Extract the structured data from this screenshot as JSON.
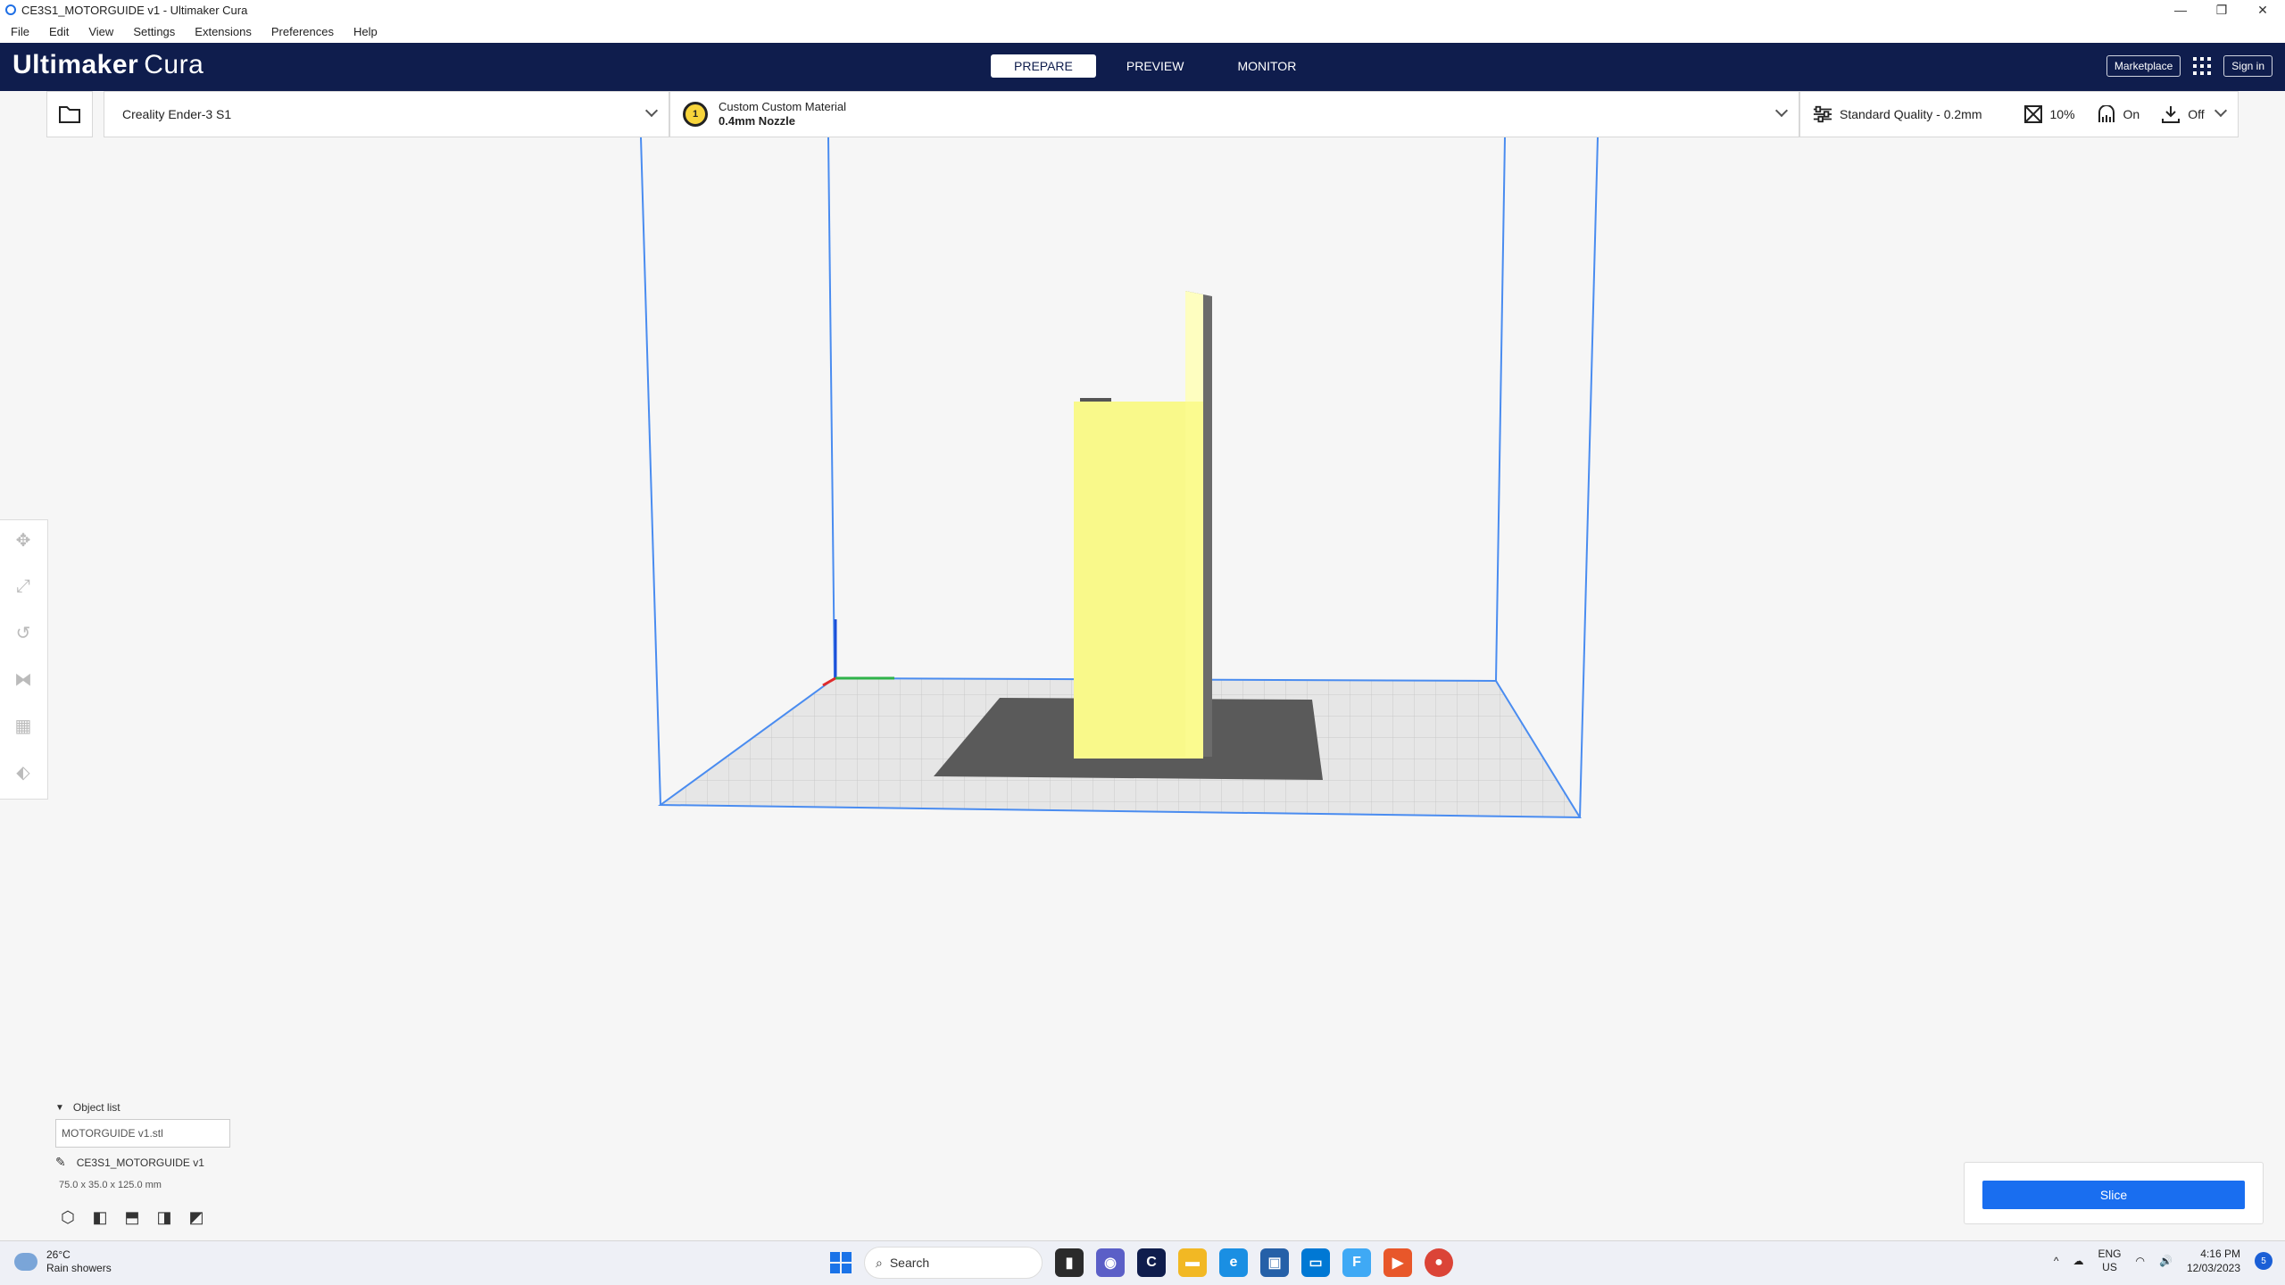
{
  "window": {
    "title": "CE3S1_MOTORGUIDE v1 - Ultimaker Cura",
    "controls": {
      "minimize": "—",
      "maximize": "❐",
      "close": "✕"
    }
  },
  "menu": [
    "File",
    "Edit",
    "View",
    "Settings",
    "Extensions",
    "Preferences",
    "Help"
  ],
  "header": {
    "logo_bold": "Ultimaker",
    "logo_thin": "Cura",
    "stages": [
      {
        "label": "PREPARE",
        "active": true
      },
      {
        "label": "PREVIEW",
        "active": false
      },
      {
        "label": "MONITOR",
        "active": false
      }
    ],
    "marketplace": "Marketplace",
    "signin": "Sign in"
  },
  "printer": {
    "name": "Creality Ender-3 S1"
  },
  "material": {
    "extruder_number": "1",
    "name": "Custom Custom Material",
    "nozzle": "0.4mm Nozzle",
    "extruder_color": "#f7d43b"
  },
  "quality": {
    "profile": "Standard Quality - 0.2mm",
    "infill": "10%",
    "support": "On",
    "adhesion": "Off"
  },
  "tools": [
    "move-icon",
    "scale-icon",
    "rotate-icon",
    "mirror-icon",
    "per-model-settings-icon",
    "support-blocker-icon"
  ],
  "objects": {
    "list_label": "Object list",
    "file": "MOTORGUIDE v1.stl",
    "job_name": "CE3S1_MOTORGUIDE v1",
    "dimensions": "75.0 x 35.0 x 125.0 mm"
  },
  "slice": {
    "label": "Slice",
    "color": "#196ef0"
  },
  "taskbar": {
    "temp": "26°C",
    "weather": "Rain showers",
    "search": "Search",
    "lang_top": "ENG",
    "lang_bottom": "US",
    "time": "4:16 PM",
    "date": "12/03/2023",
    "notifications": "5"
  },
  "colors": {
    "header_bg": "#0f1d4d",
    "build_volume_line": "#4a8cf0",
    "model": "#fdfd9a",
    "model_shadow": "#5a5a5a"
  }
}
